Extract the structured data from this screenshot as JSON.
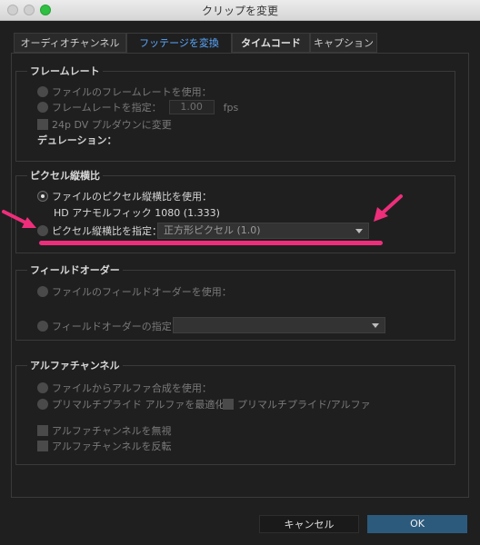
{
  "window": {
    "title": "クリップを変更"
  },
  "tabs": [
    {
      "label": "オーディオチャンネル"
    },
    {
      "label": "フッテージを変換"
    },
    {
      "label": "タイムコード"
    },
    {
      "label": "キャプション"
    }
  ],
  "framerate": {
    "title": "フレームレート",
    "use_file": "ファイルのフレームレートを使用：",
    "assume": "フレームレートを指定：",
    "value": "1.00",
    "unit": "fps",
    "pulldown": "24p DV プルダウンに変更",
    "duration": "デュレーション："
  },
  "pixel_aspect": {
    "title": "ピクセル縦横比",
    "use_file": "ファイルのピクセル縦横比を使用：",
    "file_value": "HD アナモルフィック 1080 (1.333)",
    "conform": "ピクセル縦横比を指定：",
    "selected": "正方形ピクセル (1.0)"
  },
  "field_order": {
    "title": "フィールドオーダー",
    "use_file": "ファイルのフィールドオーダーを使用：",
    "conform": "フィールドオーダーの指定："
  },
  "alpha": {
    "title": "アルファチャンネル",
    "use_file": "ファイルからアルファ合成を使用：",
    "premultiply": "プリマルチプライド アルファを最適化：",
    "premultiply_check": "プリマルチプライド/アルファ",
    "ignore": "アルファチャンネルを無視",
    "invert": "アルファチャンネルを反転"
  },
  "buttons": {
    "cancel": "キャンセル",
    "ok": "OK"
  },
  "colors": {
    "accent_pink": "#ee2e7b",
    "active_tab": "#5aa8ff",
    "ok_button": "#2c5a7d"
  }
}
